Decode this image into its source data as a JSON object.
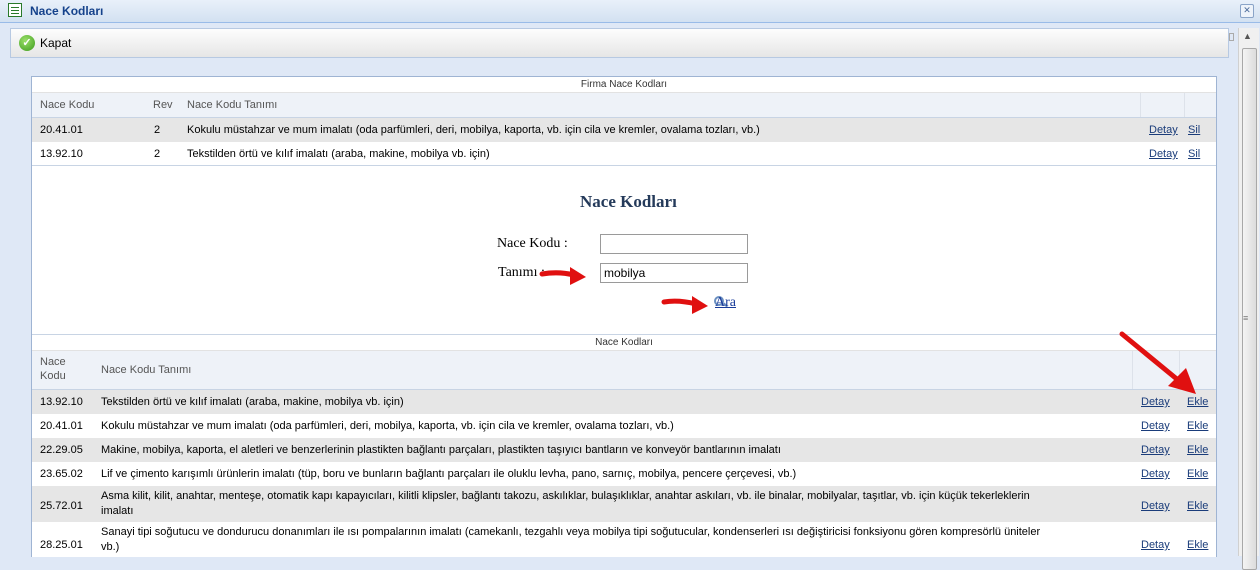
{
  "window": {
    "title": "Nace Kodları"
  },
  "toolbar": {
    "close_label": "Kapat"
  },
  "firma": {
    "section_title": "Firma Nace Kodları",
    "headers": {
      "code": "Nace Kodu",
      "rev": "Rev",
      "desc": "Nace Kodu Tanımı"
    },
    "rows": [
      {
        "code": "20.41.01",
        "rev": "2",
        "desc": "Kokulu müstahzar ve mum imalatı (oda parfümleri, deri, mobilya, kaporta, vb. için cila ve kremler, ovalama tozları, vb.)",
        "detail": "Detay",
        "delete": "Sil"
      },
      {
        "code": "13.92.10",
        "rev": "2",
        "desc": "Tekstilden örtü ve kılıf imalatı (araba, makine, mobilya vb. için)",
        "detail": "Detay",
        "delete": "Sil"
      }
    ]
  },
  "search": {
    "title": "Nace Kodları",
    "code_label": "Nace Kodu :",
    "code_value": "",
    "desc_label": "Tanımı :",
    "desc_value": "mobilya",
    "search_label": "Ara"
  },
  "results": {
    "section_title": "Nace Kodları",
    "headers": {
      "code_line1": "Nace",
      "code_line2": "Kodu",
      "desc": "Nace Kodu Tanımı"
    },
    "rows": [
      {
        "code": "13.92.10",
        "desc": "Tekstilden örtü ve kılıf imalatı (araba, makine, mobilya vb. için)",
        "detail": "Detay",
        "add": "Ekle"
      },
      {
        "code": "20.41.01",
        "desc": "Kokulu müstahzar ve mum imalatı (oda parfümleri, deri, mobilya, kaporta, vb. için cila ve kremler, ovalama tozları, vb.)",
        "detail": "Detay",
        "add": "Ekle"
      },
      {
        "code": "22.29.05",
        "desc": "Makine, mobilya, kaporta, el aletleri ve benzerlerinin plastikten bağlantı parçaları, plastikten taşıyıcı bantların ve konveyör bantlarının imalatı",
        "detail": "Detay",
        "add": "Ekle"
      },
      {
        "code": "23.65.02",
        "desc": "Lif ve çimento karışımlı ürünlerin imalatı (tüp, boru ve bunların bağlantı parçaları ile oluklu levha, pano, sarnıç, mobilya, pencere çerçevesi, vb.)",
        "detail": "Detay",
        "add": "Ekle"
      },
      {
        "code": "25.72.01",
        "desc_line1": "Asma kilit, kilit, anahtar, menteşe, otomatik kapı kapayıcıları, kilitli klipsler, bağlantı takozu, askılıklar, bulaşıklıklar, anahtar askıları, vb. ile binalar, mobilyalar, taşıtlar, vb. için küçük tekerleklerin",
        "desc_line2": "imalatı",
        "detail": "Detay",
        "add": "Ekle"
      },
      {
        "code": "28.25.01",
        "desc_line1": "Sanayi tipi soğutucu ve dondurucu donanımları ile ısı pompalarının imalatı (camekanlı, tezgahlı veya mobilya tipi soğutucular, kondenserleri ısı değiştiricisi fonksiyonu gören kompresörlü üniteler",
        "desc_line2": "vb.)",
        "detail": "Detay",
        "add": "Ekle"
      }
    ]
  },
  "colors": {
    "accent": "#15428b",
    "arrow": "#e01010",
    "link": "#1a3c7a"
  }
}
